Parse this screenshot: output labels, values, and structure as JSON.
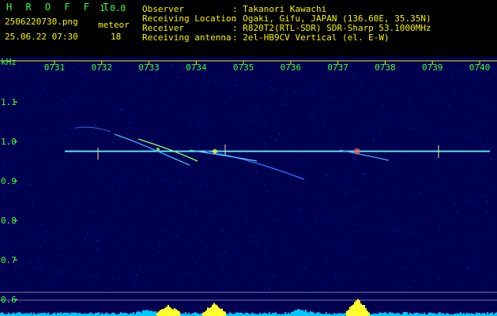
{
  "header": {
    "app_name": "H R O F F T",
    "version": "1.0.0",
    "filename": "2506220730.png",
    "datetime": "25.06.22 07:30",
    "meteor_label": "meteor",
    "meteor_count": "18",
    "info": [
      {
        "key": "Observer",
        "value": ": Takanori Kawachi"
      },
      {
        "key": "Receiving Location",
        "value": ": Ogaki, Gifu, JAPAN (136.60E, 35.35N)"
      },
      {
        "key": "Receiver",
        "value": ": R820T2(RTL-SDR) SDR-Sharp 53.1000MHz"
      },
      {
        "key": "Receiving antenna",
        "value": ": 2el-HB9CV Vertical (el. E-W)"
      }
    ]
  },
  "chart_data": {
    "type": "heatmap",
    "ylabel": "kHz",
    "x_ticks": [
      "0731",
      "0732",
      "0733",
      "0734",
      "0735",
      "0736",
      "0737",
      "0738",
      "0739",
      "0740"
    ],
    "y_ticks": [
      "1.1",
      "1.0",
      "0.9",
      "0.8",
      "0.7",
      "0.6"
    ],
    "ylim": [
      0.58,
      1.17
    ],
    "carrier_khz": 0.975,
    "colors": {
      "background": "#000050",
      "text_green": "#3cff3c",
      "text_yellow": "#f4f400",
      "axis": "#f4f400",
      "power": "#00c8ff",
      "power_peak": "#ffff30"
    }
  }
}
